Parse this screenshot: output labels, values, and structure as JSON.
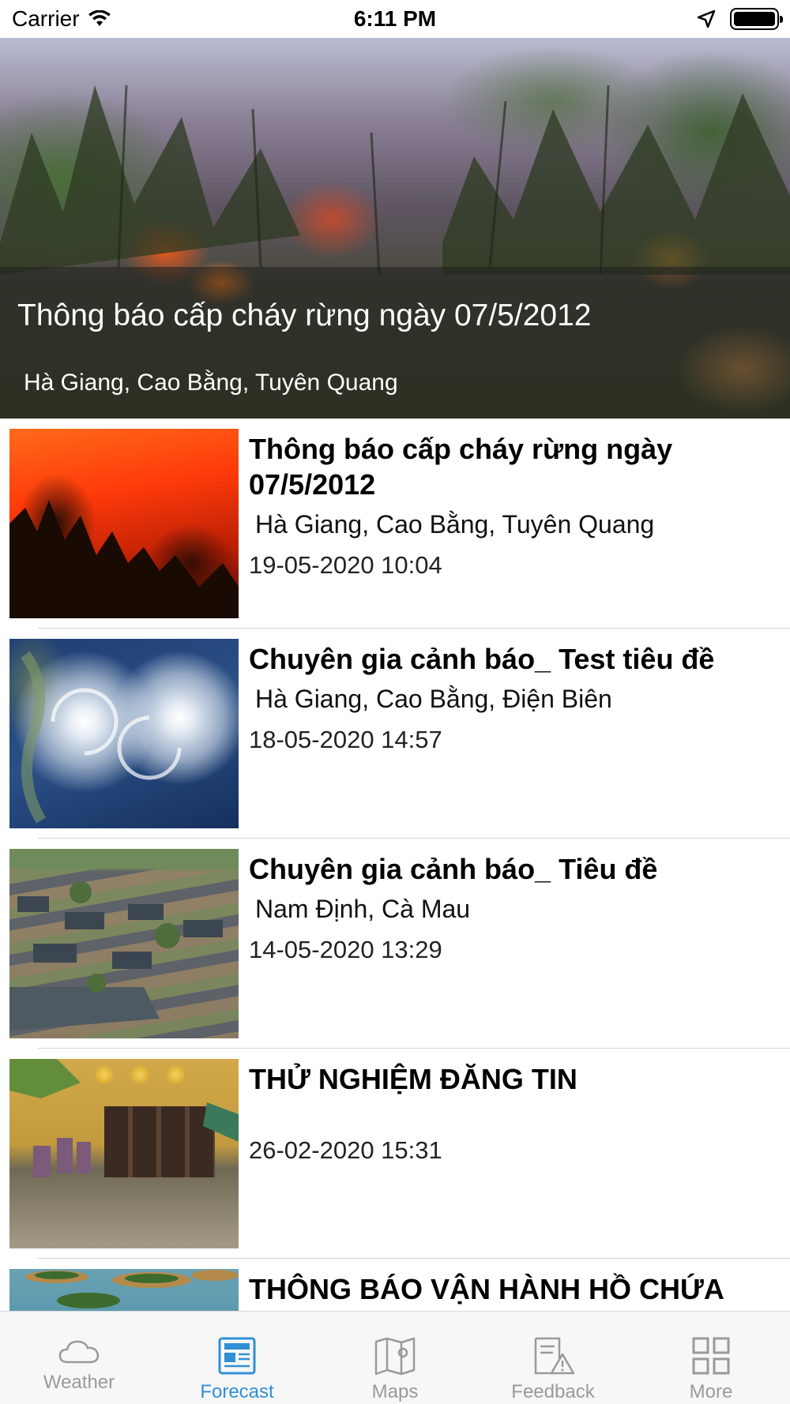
{
  "status_bar": {
    "carrier": "Carrier",
    "time": "6:11 PM"
  },
  "hero": {
    "title": "Thông báo cấp cháy rừng ngày 07/5/2012",
    "subtitle": "Hà Giang, Cao Bằng, Tuyên Quang"
  },
  "news": [
    {
      "title": "Thông báo cấp cháy rừng ngày 07/5/2012",
      "region": "Hà Giang, Cao Bằng, Tuyên Quang",
      "date": "19-05-2020 10:04",
      "thumb": "forest-fire-image"
    },
    {
      "title": "Chuyên gia cảnh báo_ Test tiêu đề",
      "region": "Hà Giang, Cao Bằng, Điện Biên",
      "date": "18-05-2020 14:57",
      "thumb": "typhoon-satellite-image"
    },
    {
      "title": "Chuyên gia cảnh báo_ Tiêu đề",
      "region": "Nam Định, Cà Mau",
      "date": "14-05-2020 13:29",
      "thumb": "flooded-village-image"
    },
    {
      "title": "THỬ NGHIỆM ĐĂNG TIN",
      "region": "",
      "date": "26-02-2020 15:31",
      "thumb": "flooded-street-image"
    },
    {
      "title": "THÔNG BÁO VẬN HÀNH HỒ CHỨA",
      "region": "",
      "date": "",
      "thumb": "reservoir-image"
    }
  ],
  "tab_bar": {
    "active_color": "#2f90d8",
    "inactive_color": "#9a9a9a",
    "tabs": [
      {
        "label": "Weather",
        "icon": "cloud-icon",
        "active": false
      },
      {
        "label": "Forecast",
        "icon": "newspaper-icon",
        "active": true
      },
      {
        "label": "Maps",
        "icon": "map-icon",
        "active": false
      },
      {
        "label": "Feedback",
        "icon": "feedback-warning-icon",
        "active": false
      },
      {
        "label": "More",
        "icon": "grid-icon",
        "active": false
      }
    ]
  }
}
